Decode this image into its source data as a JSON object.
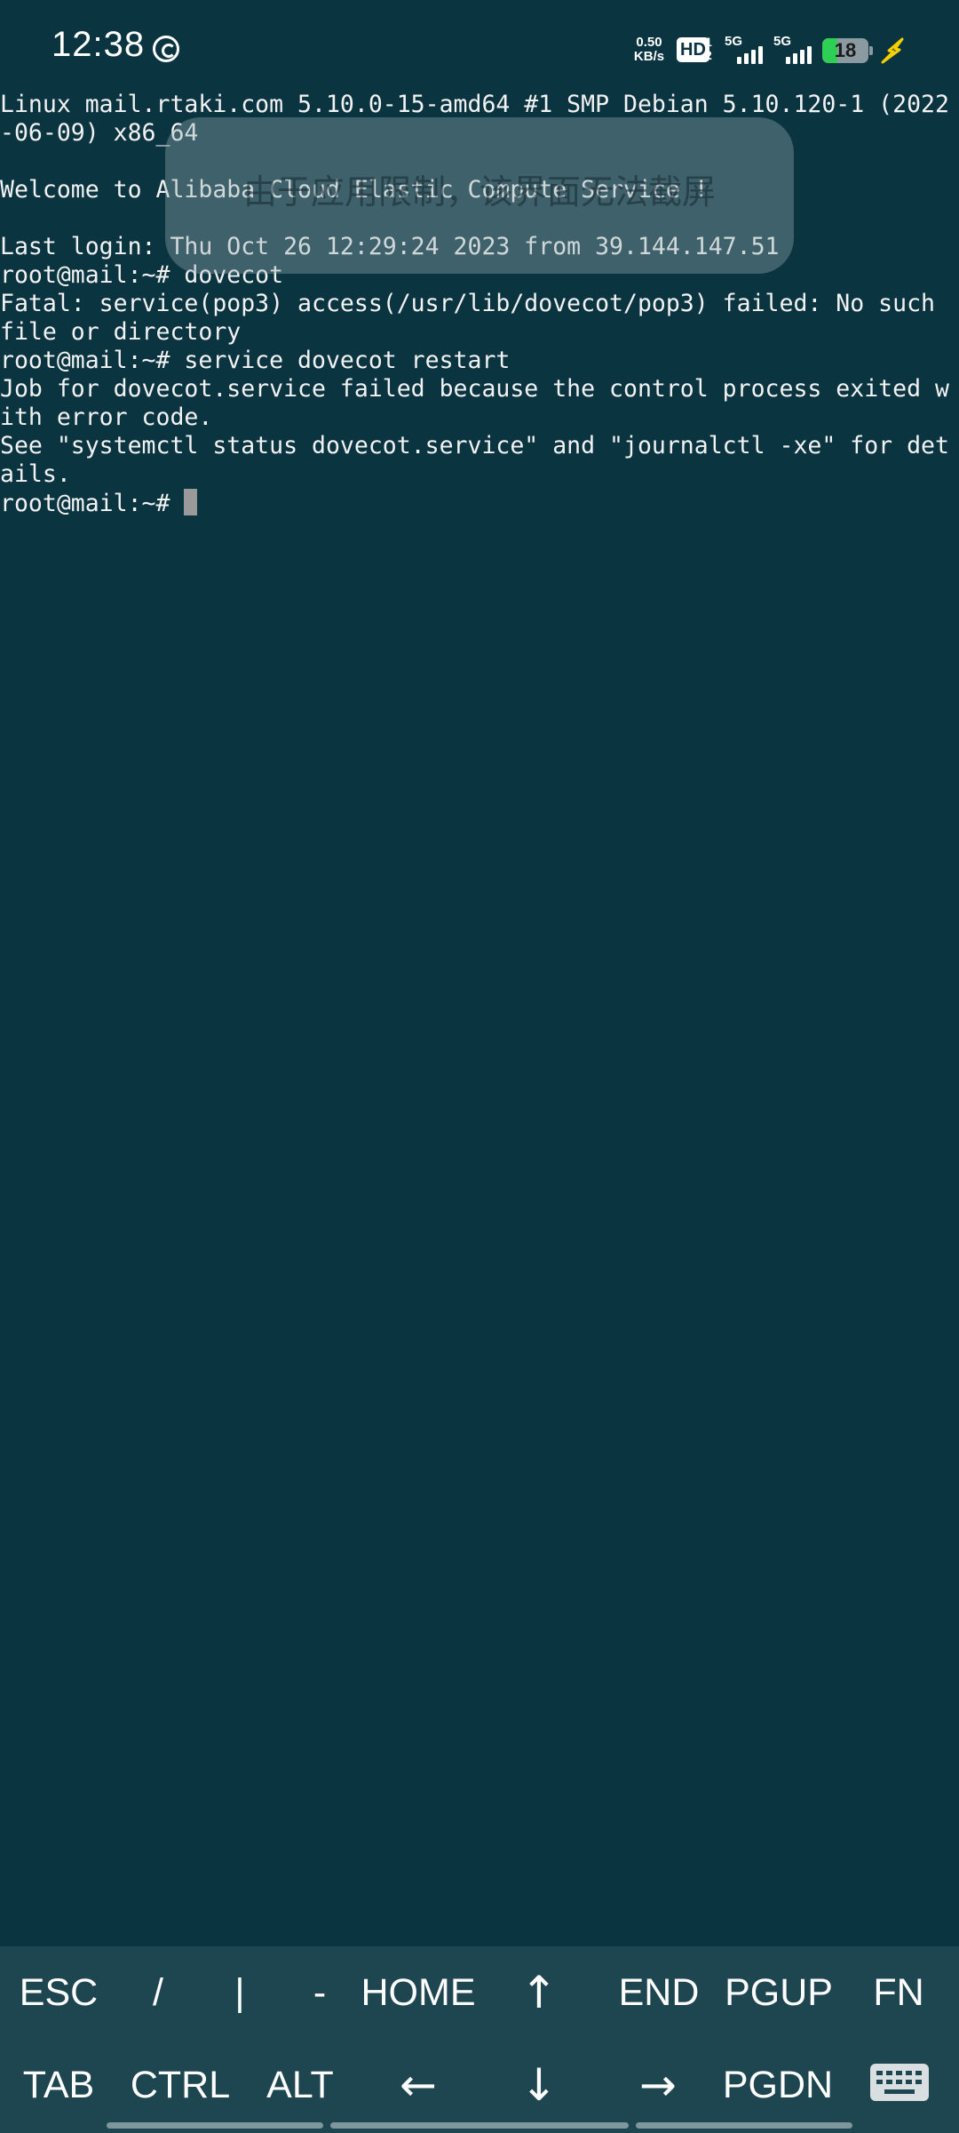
{
  "status_bar": {
    "time": "12:38",
    "app_icon": "sync-icon",
    "net_speed_value": "0.50",
    "net_speed_unit": "KB/s",
    "hd_label": "HD",
    "hd_sub_top": "1",
    "hd_sub_bottom": "2",
    "signal_1_label": "5G",
    "signal_2_label": "5G",
    "battery_level": "18",
    "battery_fraction": 0.18,
    "battery_fill_color": "#2fce55",
    "charging_icon": "lightning-icon",
    "charging_color": "#f5d000"
  },
  "terminal": {
    "background": "#0b3441",
    "lines": [
      "Linux mail.rtaki.com 5.10.0-15-amd64 #1 SMP Debian 5.10.120-1 (2022",
      "-06-09) x86_64",
      "",
      "Welcome to Alibaba Cloud Elastic Compute Service !",
      "",
      "Last login: Thu Oct 26 12:29:24 2023 from 39.144.147.51",
      "root@mail:~# dovecot",
      "Fatal: service(pop3) access(/usr/lib/dovecot/pop3) failed: No such",
      "file or directory",
      "root@mail:~# service dovecot restart",
      "Job for dovecot.service failed because the control process exited w",
      "ith error code.",
      "See \"systemctl status dovecot.service\" and \"journalctl -xe\" for det",
      "ails."
    ],
    "prompt": "root@mail:~# "
  },
  "toast": {
    "message": "由于应用限制，该界面无法截屏"
  },
  "extra_keys": {
    "row1": [
      "ESC",
      "/",
      "|",
      "-",
      "HOME",
      "↑",
      "END",
      "PGUP",
      "FN"
    ],
    "row2": [
      "TAB",
      "CTRL",
      "ALT",
      "←",
      "↓",
      "→",
      "PGDN"
    ],
    "keyboard_icon": "keyboard-icon"
  }
}
